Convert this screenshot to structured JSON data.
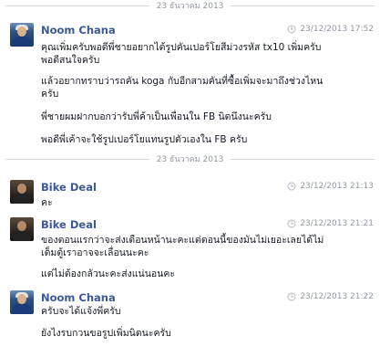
{
  "separators": [
    {
      "label": "23 ธันวาคม 2013"
    },
    {
      "label": "23 ธันวาคม 2013"
    }
  ],
  "messages": [
    {
      "sender": "Noom Chana",
      "time": "23/12/2013 17:52",
      "lines": [
        "คุณเพิ่มครับพอดีพี่ชายอยากได้รูปคันเปอร์โยสีม่วงรหัส tx10 เพิ่มครับ",
        "พอดีสนใจครับ",
        "แล้วอยากทราบว่ารถคัน koga กับอีกสามคันที่ซื้อเพิ่มจะมาถึงช่วงไหน",
        "ครับ",
        "พี่ชายผมฝากบอกว่ารับพี่ค้าเป็นเพื่อนใน FB นิดนึงนะครับ",
        "พอดีพี่เค้าจะใช้รูปเปอร์โยแทนรูปตัวเองใน FB ครับ"
      ]
    },
    {
      "sender": "Bike Deal",
      "time": "23/12/2013 21:13",
      "lines": [
        "คะ"
      ]
    },
    {
      "sender": "Bike Deal",
      "time": "23/12/2013 21:21",
      "lines": [
        "ของตอนแรกว่าจะส่งเดือนหน้านะคะแต่ตอนนี้ของมันไม่เยอะเลยได้ไม่",
        "เต็มตู้เราอาจจะเลื่อนนะคะ",
        "แต่ไม่ต้องกลัวนะคะส่งแน่นอนคะ"
      ]
    },
    {
      "sender": "Noom Chana",
      "time": "23/12/2013 21:22",
      "lines": [
        "ครับจะได้แจ้งพี่ครับ",
        "ยังไงรบกวนขอรูปเพิ่มนิดนะครับ"
      ]
    }
  ]
}
